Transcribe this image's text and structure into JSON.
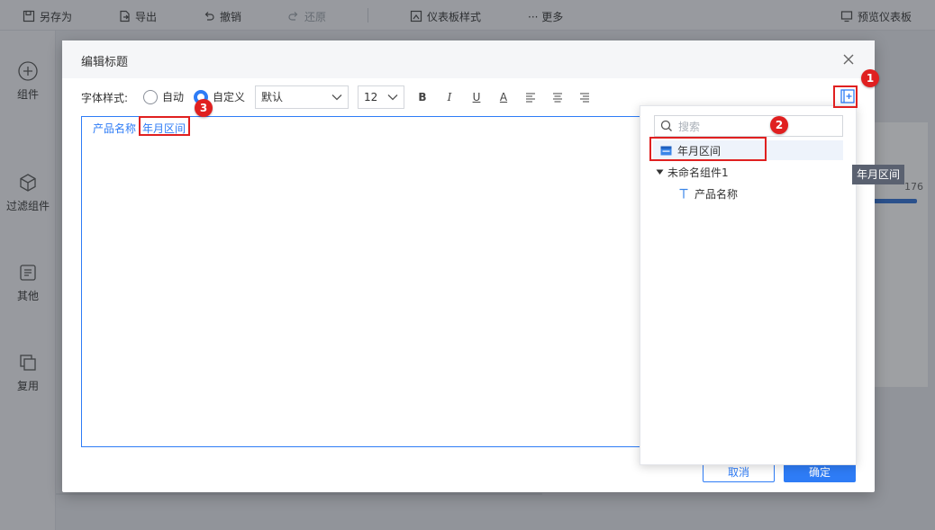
{
  "toolbar": {
    "save_as": "另存为",
    "export": "导出",
    "undo": "撤销",
    "redo": "还原",
    "dashboard_style": "仪表板样式",
    "more": "··· 更多",
    "preview": "预览仪表板"
  },
  "sidebar": {
    "items": [
      {
        "label": "组件",
        "icon": "plus-circle-icon"
      },
      {
        "label": "过滤组件",
        "icon": "cube-icon"
      },
      {
        "label": "其他",
        "icon": "document-icon"
      },
      {
        "label": "复用",
        "icon": "copy-icon"
      }
    ]
  },
  "behind": {
    "number": "176"
  },
  "dialog": {
    "title": "编辑标题",
    "font_style_label": "字体样式:",
    "radio_auto": "自动",
    "radio_custom": "自定义",
    "radio_selected": "自定义",
    "font_family": "默认",
    "font_size": "12",
    "format_buttons": {
      "bold": "B",
      "italic": "I",
      "underline": "U",
      "color": "A"
    },
    "editor_tags": [
      "产品名称",
      "年月区间"
    ],
    "cancel": "取消",
    "ok": "确定"
  },
  "field_popup": {
    "search_placeholder": "搜索",
    "items": [
      {
        "label": "年月区间",
        "icon": "calendar-icon"
      },
      {
        "label": "未命名组件1",
        "icon": "triangle-down-icon"
      },
      {
        "label": "产品名称",
        "icon": "text-t-icon"
      }
    ],
    "tooltip": "年月区间"
  },
  "callouts": [
    "1",
    "2",
    "3"
  ],
  "colors": {
    "accent": "#2e7cf6",
    "callout": "#e02020"
  }
}
